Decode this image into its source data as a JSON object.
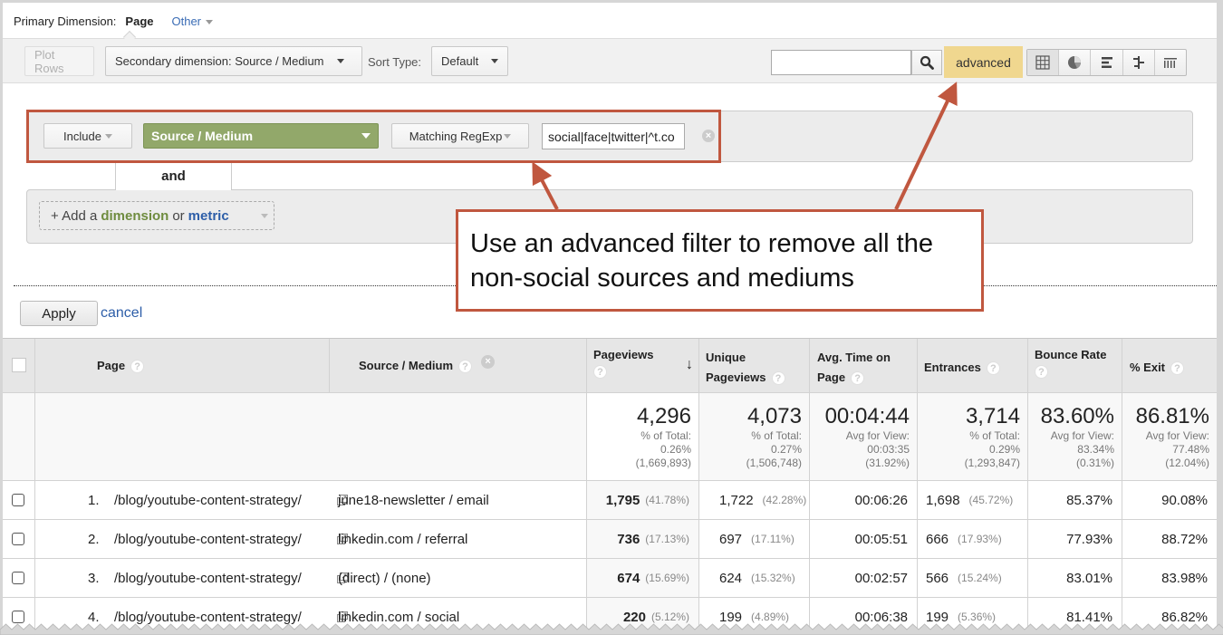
{
  "primary_dimension": {
    "label": "Primary Dimension:",
    "selected": "Page",
    "other": "Other"
  },
  "toolbar": {
    "plot_rows": "Plot Rows",
    "secondary_dimension": "Secondary dimension: Source / Medium",
    "sort_type_label": "Sort Type:",
    "sort_type_value": "Default",
    "search_value": "",
    "advanced": "advanced",
    "view_icons": [
      "table-view-icon",
      "pie-view-icon",
      "bar-view-icon",
      "comparison-view-icon",
      "pivot-view-icon"
    ]
  },
  "filter": {
    "include": "Include",
    "dimension": "Source / Medium",
    "match_type": "Matching RegExp",
    "regex_value": "social|face|twitter|^t.co",
    "and_label": "and",
    "add_prefix": "+ Add a",
    "add_dimension": "dimension",
    "add_or": "or",
    "add_metric": "metric",
    "apply": "Apply",
    "cancel": "cancel"
  },
  "annotation": {
    "text": "Use an advanced filter to remove all the non-social sources and mediums",
    "color": "#c0573f"
  },
  "table": {
    "headers": {
      "page": "Page",
      "source_medium": "Source / Medium",
      "pageviews": "Pageviews",
      "unique_pageviews_1": "Unique",
      "unique_pageviews_2": "Pageviews",
      "avg_time_1": "Avg. Time on",
      "avg_time_2": "Page",
      "entrances": "Entrances",
      "bounce_rate": "Bounce Rate",
      "exit": "% Exit"
    },
    "totals": {
      "pageviews": {
        "value": "4,296",
        "l1": "% of Total:",
        "l2": "0.26%",
        "l3": "(1,669,893)"
      },
      "unique_pageviews": {
        "value": "4,073",
        "l1": "% of Total:",
        "l2": "0.27%",
        "l3": "(1,506,748)"
      },
      "avg_time": {
        "value": "00:04:44",
        "l1": "Avg for View:",
        "l2": "00:03:35",
        "l3": "(31.92%)"
      },
      "entrances": {
        "value": "3,714",
        "l1": "% of Total:",
        "l2": "0.29%",
        "l3": "(1,293,847)"
      },
      "bounce_rate": {
        "value": "83.60%",
        "l1": "Avg for View:",
        "l2": "83.34%",
        "l3": "(0.31%)"
      },
      "exit": {
        "value": "86.81%",
        "l1": "Avg for View:",
        "l2": "77.48%",
        "l3": "(12.04%)"
      }
    },
    "rows": [
      {
        "num": "1.",
        "page": "/blog/youtube-content-strategy/",
        "source": "june18-newsletter / email",
        "pageviews": "1,795",
        "pageviews_pct": "(41.78%)",
        "unique": "1,722",
        "unique_pct": "(42.28%)",
        "avg_time": "00:06:26",
        "entrances": "1,698",
        "entrances_pct": "(45.72%)",
        "bounce": "85.37%",
        "exit": "90.08%"
      },
      {
        "num": "2.",
        "page": "/blog/youtube-content-strategy/",
        "source": "linkedin.com / referral",
        "pageviews": "736",
        "pageviews_pct": "(17.13%)",
        "unique": "697",
        "unique_pct": "(17.11%)",
        "avg_time": "00:05:51",
        "entrances": "666",
        "entrances_pct": "(17.93%)",
        "bounce": "77.93%",
        "exit": "88.72%"
      },
      {
        "num": "3.",
        "page": "/blog/youtube-content-strategy/",
        "source": "(direct) / (none)",
        "pageviews": "674",
        "pageviews_pct": "(15.69%)",
        "unique": "624",
        "unique_pct": "(15.32%)",
        "avg_time": "00:02:57",
        "entrances": "566",
        "entrances_pct": "(15.24%)",
        "bounce": "83.01%",
        "exit": "83.98%"
      },
      {
        "num": "4.",
        "page": "/blog/youtube-content-strategy/",
        "source": "linkedin.com / social",
        "pageviews": "220",
        "pageviews_pct": "(5.12%)",
        "unique": "199",
        "unique_pct": "(4.89%)",
        "avg_time": "00:06:38",
        "entrances": "199",
        "entrances_pct": "(5.36%)",
        "bounce": "81.41%",
        "exit": "86.82%"
      }
    ]
  }
}
